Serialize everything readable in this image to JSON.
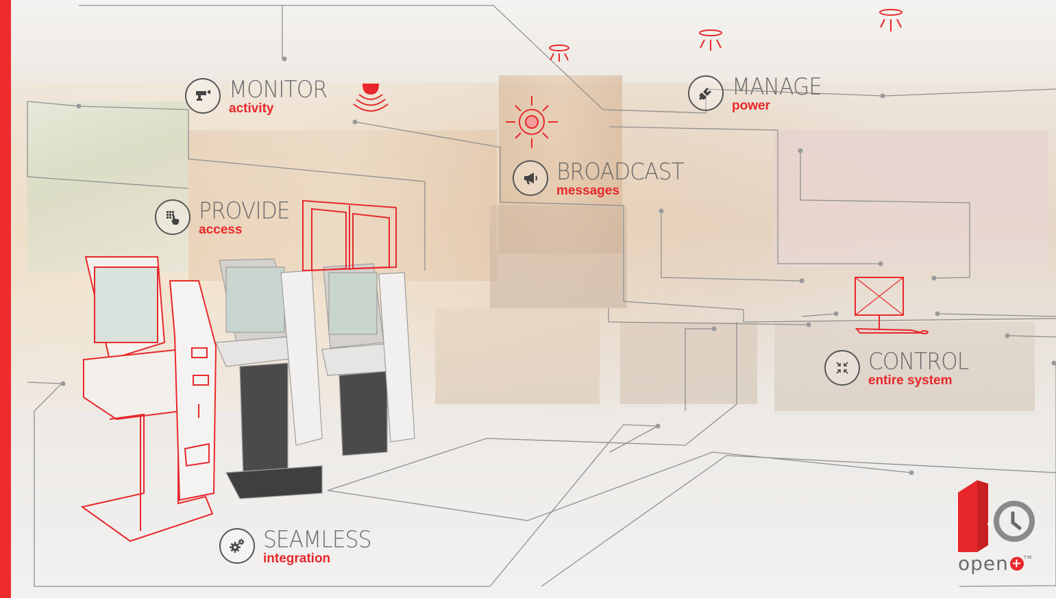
{
  "colors": {
    "accent": "#e8272b",
    "side_bar": "#ef2b2d",
    "text_gray": "#6a6a6a",
    "line_gray": "#8a8a8a"
  },
  "features": [
    {
      "key": "monitor",
      "title": "MONITOR",
      "subtitle": "activity",
      "icon": "security-camera-icon"
    },
    {
      "key": "manage",
      "title": "MANAGE",
      "subtitle": "power",
      "icon": "power-plug-icon"
    },
    {
      "key": "broadcast",
      "title": "BROADCAST",
      "subtitle": "messages",
      "icon": "megaphone-icon"
    },
    {
      "key": "provide",
      "title": "PROVIDE",
      "subtitle": "access",
      "icon": "keypad-touch-icon"
    },
    {
      "key": "control",
      "title": "CONTROL",
      "subtitle": "entire system",
      "icon": "compress-arrows-icon"
    },
    {
      "key": "seamless",
      "title": "SEAMLESS",
      "subtitle": "integration",
      "icon": "gears-icon"
    }
  ],
  "logo": {
    "wordmark": "open",
    "plus_symbol": "+",
    "trademark": "TM",
    "icon": "door-clock-icon"
  }
}
